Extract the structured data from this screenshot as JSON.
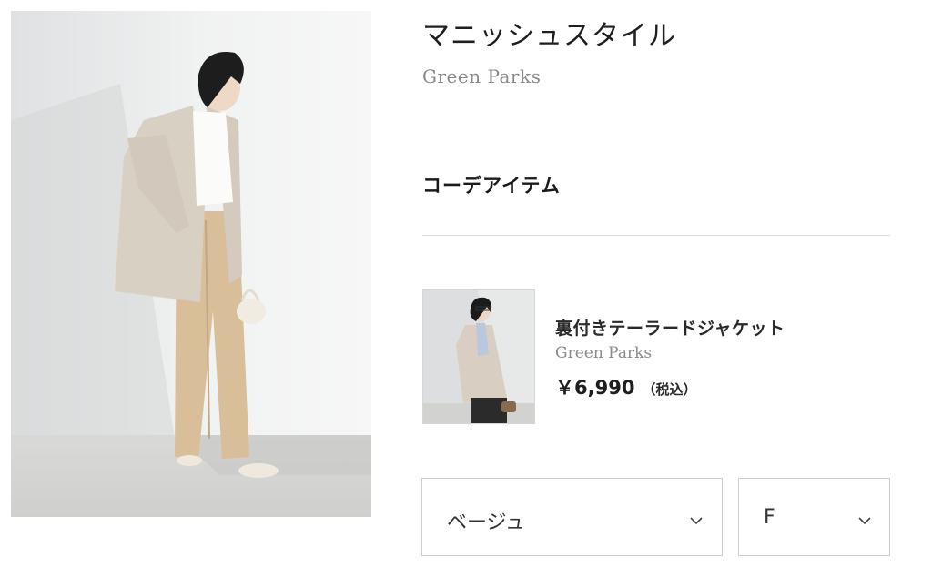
{
  "look": {
    "title": "マニッシュスタイル",
    "brand": "Green Parks"
  },
  "coordinate_section": {
    "heading": "コーデアイテム"
  },
  "item": {
    "name": "裏付きテーラードジャケット",
    "brand": "Green Parks",
    "price": "￥6,990",
    "tax_note": "（税込）"
  },
  "selectors": {
    "color_value": "ベージュ",
    "size_value": "F"
  },
  "icons": {
    "chevron": "chevron-down-icon"
  },
  "colors": {
    "text_primary": "#1f1f1f",
    "text_muted": "#8b8b8b",
    "border": "#cfcfcf",
    "divider": "#dcdcdc"
  }
}
